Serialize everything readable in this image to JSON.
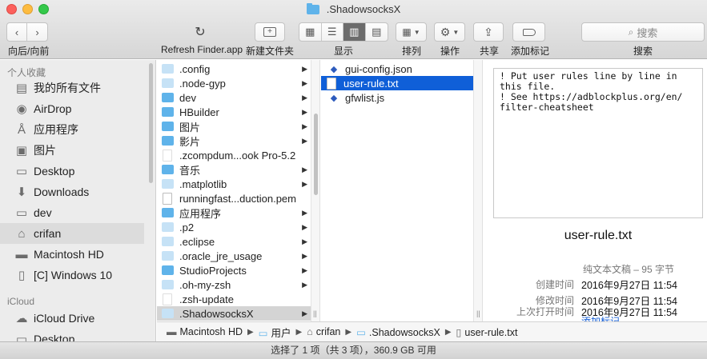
{
  "window": {
    "title": "ShadowsocksX"
  },
  "toolbar": {
    "nav_label": "向后/向前",
    "refresh_label": "Refresh Finder.app",
    "new_folder_label": "新建文件夹",
    "view_label": "显示",
    "arrange_label": "排列",
    "action_label": "操作",
    "share_label": "共享",
    "tags_label": "添加标记",
    "search_label": "搜索",
    "search_placeholder": "搜索"
  },
  "sidebar": {
    "favorites_header": "个人收藏",
    "icloud_header": "iCloud",
    "items": [
      {
        "label": "我的所有文件",
        "icon": "all-files-icon"
      },
      {
        "label": "AirDrop",
        "icon": "airdrop-icon"
      },
      {
        "label": "应用程序",
        "icon": "applications-icon"
      },
      {
        "label": "图片",
        "icon": "camera-icon"
      },
      {
        "label": "Desktop",
        "icon": "desktop-icon"
      },
      {
        "label": "Downloads",
        "icon": "downloads-icon"
      },
      {
        "label": "dev",
        "icon": "folder-icon"
      },
      {
        "label": "crifan",
        "icon": "home-icon"
      },
      {
        "label": "Macintosh HD",
        "icon": "hard-drive-icon"
      },
      {
        "label": "[C] Windows 10",
        "icon": "document-icon"
      }
    ],
    "icloud_items": [
      {
        "label": "iCloud Drive",
        "icon": "icloud-icon"
      },
      {
        "label": "Desktop",
        "icon": "desktop-icon"
      }
    ]
  },
  "column1": {
    "items": [
      {
        "label": ".config",
        "type": "folder-light"
      },
      {
        "label": ".node-gyp",
        "type": "folder-light"
      },
      {
        "label": "dev",
        "type": "folder"
      },
      {
        "label": "HBuilder",
        "type": "folder"
      },
      {
        "label": "图片",
        "type": "folder"
      },
      {
        "label": "影片",
        "type": "folder"
      },
      {
        "label": ".zcompdum...ook Pro-5.2",
        "type": "file-light"
      },
      {
        "label": "音乐",
        "type": "folder"
      },
      {
        "label": ".matplotlib",
        "type": "folder-light"
      },
      {
        "label": "runningfast...duction.pem",
        "type": "file"
      },
      {
        "label": "应用程序",
        "type": "folder"
      },
      {
        "label": ".p2",
        "type": "folder-light"
      },
      {
        "label": ".eclipse",
        "type": "folder-light"
      },
      {
        "label": ".oracle_jre_usage",
        "type": "folder-light"
      },
      {
        "label": "StudioProjects",
        "type": "folder"
      },
      {
        "label": ".oh-my-zsh",
        "type": "folder-light"
      },
      {
        "label": ".zsh-update",
        "type": "file-light"
      },
      {
        "label": ".ShadowsocksX",
        "type": "folder-light"
      }
    ]
  },
  "column2": {
    "items": [
      {
        "label": "gui-config.json",
        "type": "js"
      },
      {
        "label": "user-rule.txt",
        "type": "txt"
      },
      {
        "label": "gfwlist.js",
        "type": "js"
      }
    ]
  },
  "preview": {
    "content": "! Put user rules line by line in\nthis file.\n! See https://adblockplus.org/en/\nfilter-cheatsheet",
    "filename": "user-rule.txt",
    "kind": "纯文本文稿 – 95 字节",
    "created_label": "创建时间",
    "created_value": "2016年9月27日 11:54",
    "modified_label": "修改时间",
    "modified_value": "2016年9月27日 11:54",
    "opened_label": "上次打开时间",
    "opened_value": "2016年9月27日 11:54",
    "add_tags": "添加标记..."
  },
  "pathbar": {
    "items": [
      "Macintosh HD",
      "用户",
      "crifan",
      ".ShadowsocksX",
      "user-rule.txt"
    ]
  },
  "status": {
    "text": "选择了 1 项（共 3 项），360.9 GB 可用"
  },
  "colors": {
    "selection": "#0f5fd8",
    "folder": "#5fb3ea",
    "folder_light": "#c6e2f6",
    "accent_link": "#1a62d6"
  }
}
